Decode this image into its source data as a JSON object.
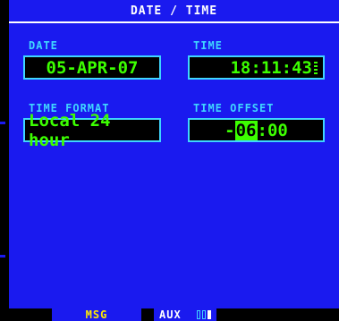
{
  "window": {
    "title": "DATE / TIME"
  },
  "date": {
    "label": "DATE",
    "value": "05-APR-07"
  },
  "time": {
    "label": "TIME",
    "value": "18:11:43"
  },
  "time_format": {
    "label": "TIME FORMAT",
    "value": "Local 24 hour"
  },
  "time_offset": {
    "label": "TIME OFFSET",
    "sign": "-",
    "cursor_digits": "06",
    "rest": ":00"
  },
  "softkeys": {
    "msg": "MSG",
    "aux": "AUX"
  },
  "colors": {
    "background": "#1a1aef",
    "label": "#3fd6ff",
    "value": "#3cff00",
    "msg": "#ffea00"
  }
}
